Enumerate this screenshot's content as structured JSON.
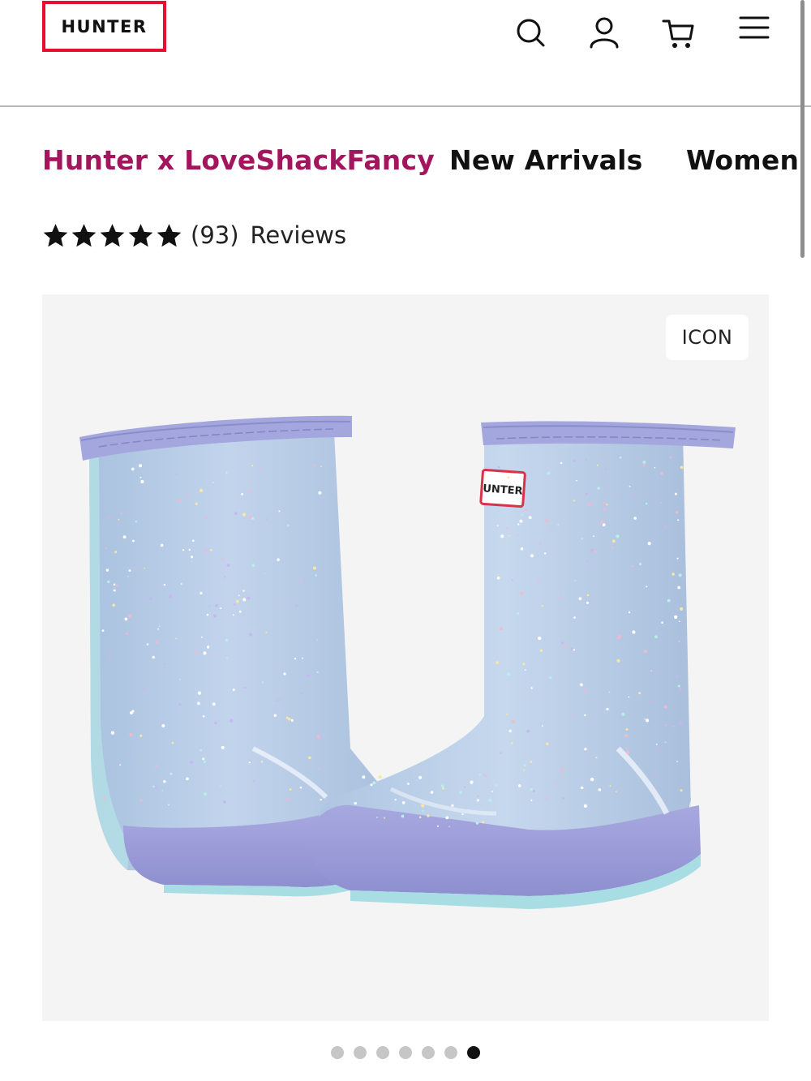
{
  "header": {
    "logo_text": "HUNTER",
    "icons": [
      "search-icon",
      "account-icon",
      "cart-icon",
      "menu-icon"
    ]
  },
  "category_nav": {
    "items": [
      {
        "label": "Hunter x LoveShackFancy",
        "active": true
      },
      {
        "label": "New Arrivals",
        "active": false
      },
      {
        "label": "Women",
        "active": false
      }
    ],
    "active_color": "#a3155d"
  },
  "rating": {
    "stars": 5,
    "count": "(93)",
    "label": "Reviews"
  },
  "product": {
    "badge": "ICON",
    "boot_heel_tab": "UNTER"
  },
  "carousel": {
    "total": 7,
    "active_index": 6
  },
  "colors": {
    "brand_red": "#e4102e",
    "boot_blue": "#b9cde6",
    "boot_lavender": "#a4a6de",
    "sole_aqua": "#a8dde4"
  }
}
